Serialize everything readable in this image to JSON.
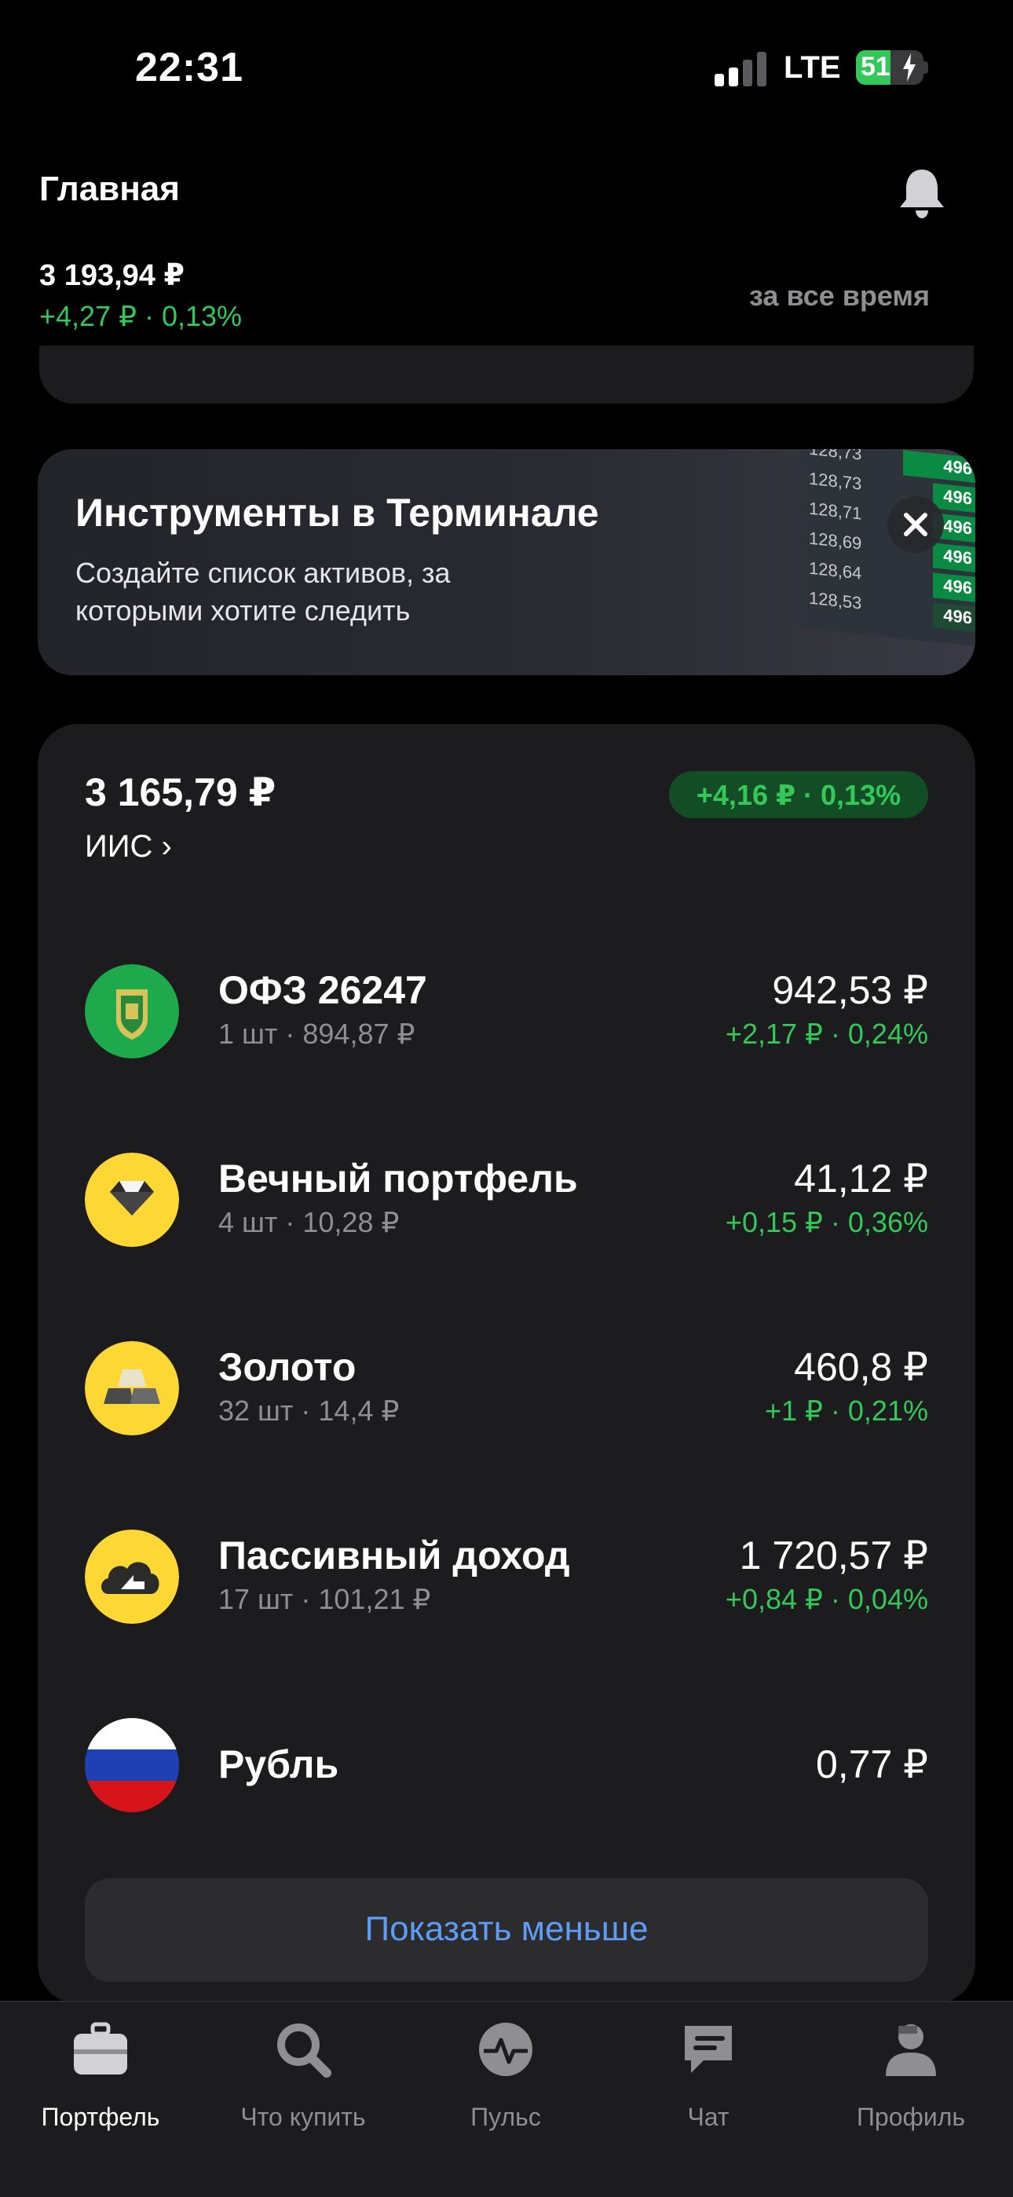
{
  "status_bar": {
    "time": "22:31",
    "network": "LTE",
    "battery": "51"
  },
  "header": {
    "title": "Главная",
    "total_value": "3 193,94 ₽",
    "total_change": "+4,27 ₽ · 0,13%",
    "period": "за все время"
  },
  "promo": {
    "title": "Инструменты в Терминале",
    "text": "Создайте список активов, за которыми хотите следить",
    "table": {
      "prices": [
        "128,73",
        "128,73",
        "128,71",
        "128,69",
        "128,64",
        "128,53"
      ],
      "volumes": [
        "496",
        "496",
        "496",
        "496",
        "496",
        "496"
      ]
    }
  },
  "account": {
    "value": "3 165,79 ₽",
    "name": "ИИС ›",
    "change": "+4,16 ₽ · 0,13%"
  },
  "assets": [
    {
      "name": "ОФЗ 26247",
      "sub": "1 шт · 894,87 ₽",
      "price": "942,53 ₽",
      "change": "+2,17 ₽ · 0,24%",
      "icon": "ofz-emblem-icon"
    },
    {
      "name": "Вечный портфель",
      "sub": "4 шт · 10,28 ₽",
      "price": "41,12 ₽",
      "change": "+0,15 ₽ · 0,36%",
      "icon": "diamond-icon"
    },
    {
      "name": "Золото",
      "sub": "32 шт · 14,4 ₽",
      "price": "460,8 ₽",
      "change": "+1 ₽ · 0,21%",
      "icon": "gold-bars-icon"
    },
    {
      "name": "Пассивный доход",
      "sub": "17 шт · 101,21 ₽",
      "price": "1 720,57 ₽",
      "change": "+0,84 ₽ · 0,04%",
      "icon": "cloud-arrow-icon"
    },
    {
      "name": "Рубль",
      "sub": "",
      "price": "0,77 ₽",
      "change": "",
      "icon": "russia-flag-icon"
    }
  ],
  "show_less_label": "Показать меньше",
  "tabs": [
    {
      "label": "Портфель",
      "icon": "briefcase-icon",
      "active": true
    },
    {
      "label": "Что купить",
      "icon": "search-icon",
      "active": false
    },
    {
      "label": "Пульс",
      "icon": "pulse-icon",
      "active": false
    },
    {
      "label": "Чат",
      "icon": "chat-icon",
      "active": false
    },
    {
      "label": "Профиль",
      "icon": "profile-icon",
      "active": false
    }
  ],
  "colors": {
    "positive": "#34c759",
    "link": "#5e9cf5",
    "card": "#1c1c1e"
  }
}
